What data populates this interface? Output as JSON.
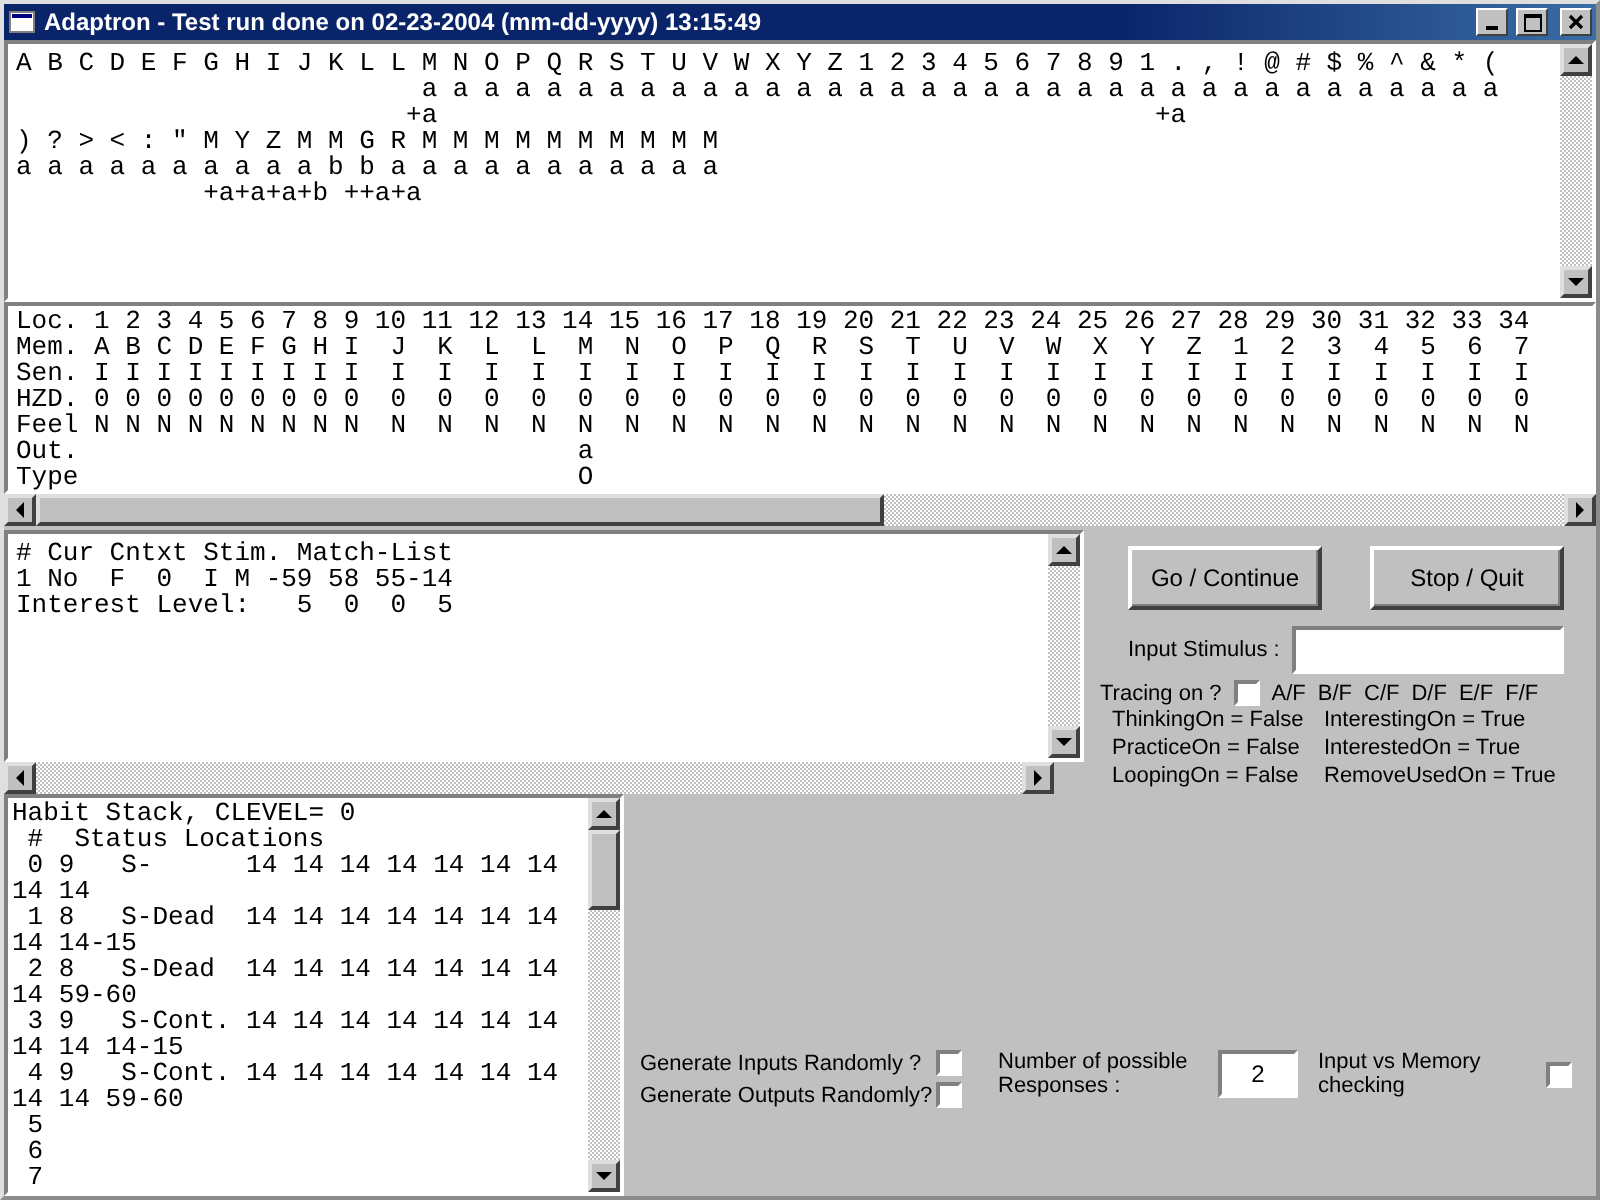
{
  "window": {
    "title": "Adaptron - Test run done on 02-23-2004 (mm-dd-yyyy) 13:15:49"
  },
  "memory_display": {
    "lines": [
      "A B C D E F G H I J K L L M N O P Q R S T U V W X Y Z 1 2 3 4 5 6 7 8 9 1 . , ! @ # $ % ^ & * (",
      "                          a a a a a a a a a a a a a a a a a a a a a a a a a a a a a a a a a a a",
      "                         +a                                              +a",
      ") ? > < : \" M Y Z M M G R M M M M M M M M M M",
      "a a a a a a a a a a b b a a a a a a a a a a a",
      "            +a+a+a+b ++a+a"
    ]
  },
  "location_grid": {
    "lines": [
      "Loc. 1 2 3 4 5 6 7 8 9 10 11 12 13 14 15 16 17 18 19 20 21 22 23 24 25 26 27 28 29 30 31 32 33 34",
      "Mem. A B C D E F G H I  J  K  L  L  M  N  O  P  Q  R  S  T  U  V  W  X  Y  Z  1  2  3  4  5  6  7",
      "Sen. I I I I I I I I I  I  I  I  I  I  I  I  I  I  I  I  I  I  I  I  I  I  I  I  I  I  I  I  I  I",
      "HZD. 0 0 0 0 0 0 0 0 0  0  0  0  0  0  0  0  0  0  0  0  0  0  0  0  0  0  0  0  0  0  0  0  0  0",
      "Feel N N N N N N N N N  N  N  N  N  N  N  N  N  N  N  N  N  N  N  N  N  N  N  N  N  N  N  N  N  N",
      "Out.                                a",
      "Type                                O"
    ]
  },
  "match_list": {
    "lines": [
      "# Cur Cntxt Stim. Match-List",
      "1 No  F  0  I M -59 58 55-14",
      "Interest Level:   5  0  0  5"
    ]
  },
  "buttons": [
    {
      "label": "Go / Continue"
    },
    {
      "label": "Stop / Quit"
    }
  ],
  "input_stimulus": {
    "label": "Input Stimulus :"
  },
  "tracing": {
    "label": "Tracing on ?",
    "checked": false,
    "options": [
      "A/F",
      "B/F",
      "C/F",
      "D/F",
      "E/F",
      "F/F"
    ]
  },
  "flags": [
    {
      "left": "ThinkingOn = False",
      "right": "InterestingOn = True"
    },
    {
      "left": "PracticeOn = False",
      "right": "InterestedOn = True"
    },
    {
      "left": "LoopingOn = False",
      "right": "RemoveUsedOn = True"
    }
  ],
  "habit_stack": {
    "lines": [
      "Habit Stack, CLEVEL= 0",
      " #  Status Locations",
      " 0 9   S-      14 14 14 14 14 14 14",
      "14 14",
      " 1 8   S-Dead  14 14 14 14 14 14 14",
      "14 14-15",
      " 2 8   S-Dead  14 14 14 14 14 14 14",
      "14 59-60",
      " 3 9   S-Cont. 14 14 14 14 14 14 14",
      "14 14 14-15",
      " 4 9   S-Cont. 14 14 14 14 14 14 14",
      "14 14 59-60",
      " 5",
      " 6",
      " 7"
    ]
  },
  "random_options": [
    {
      "label": "Generate Inputs Randomly ?",
      "checked": false
    },
    {
      "label": "Generate Outputs Randomly?",
      "checked": false
    }
  ],
  "responses": {
    "label": "Number of possible Responses :",
    "value": "2"
  },
  "memory_check": {
    "label": "Input vs Memory checking",
    "checked": false
  }
}
